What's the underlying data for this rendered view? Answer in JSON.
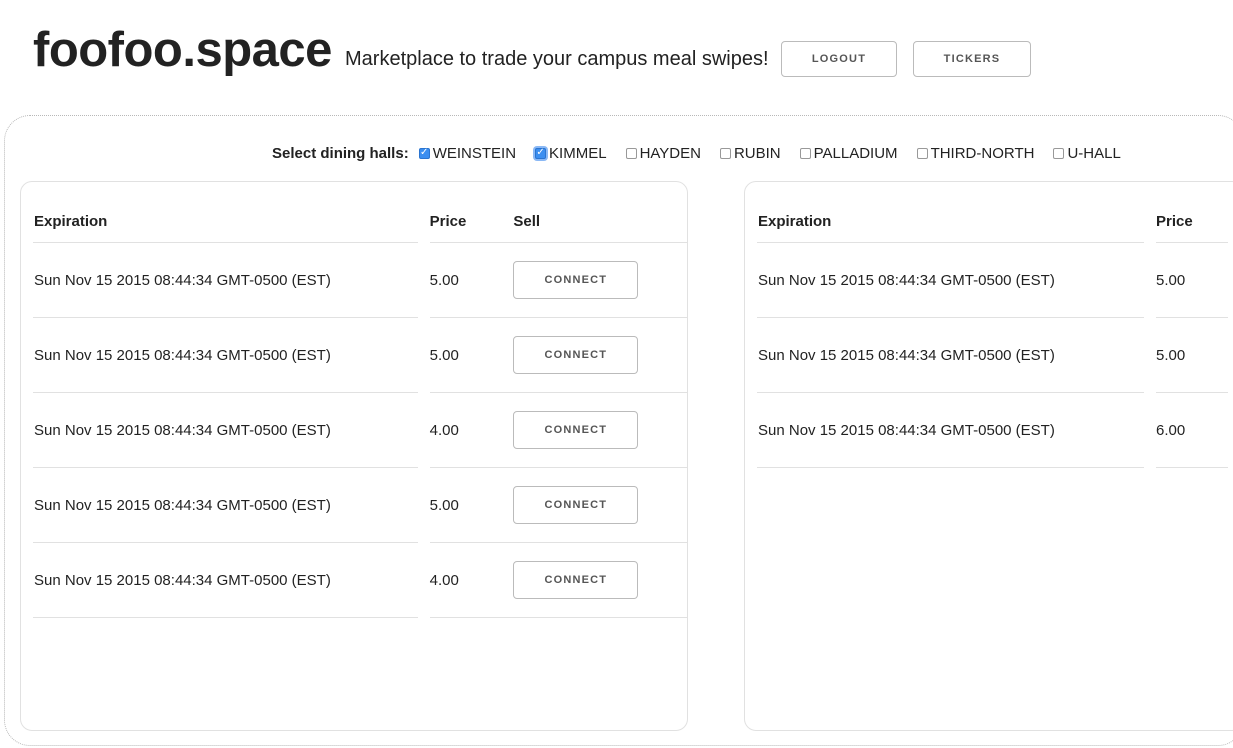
{
  "header": {
    "brand": "foofoo.space",
    "tagline": "Marketplace to trade your campus meal swipes!",
    "logout_label": "LOGOUT",
    "tickers_label": "TICKERS"
  },
  "filters": {
    "label": "Select dining halls:",
    "halls": [
      {
        "label": "WEINSTEIN",
        "checked": true
      },
      {
        "label": "KIMMEL",
        "checked": true
      },
      {
        "label": "HAYDEN",
        "checked": false
      },
      {
        "label": "RUBIN",
        "checked": false
      },
      {
        "label": "PALLADIUM",
        "checked": false
      },
      {
        "label": "THIRD-NORTH",
        "checked": false
      },
      {
        "label": "U-HALL",
        "checked": false
      }
    ]
  },
  "sell_table": {
    "columns": {
      "expiration": "Expiration",
      "price": "Price",
      "action": "Sell"
    },
    "connect_label": "CONNECT",
    "rows": [
      {
        "expiration": "Sun Nov 15 2015 08:44:34 GMT-0500 (EST)",
        "price": "5.00"
      },
      {
        "expiration": "Sun Nov 15 2015 08:44:34 GMT-0500 (EST)",
        "price": "5.00"
      },
      {
        "expiration": "Sun Nov 15 2015 08:44:34 GMT-0500 (EST)",
        "price": "4.00"
      },
      {
        "expiration": "Sun Nov 15 2015 08:44:34 GMT-0500 (EST)",
        "price": "5.00"
      },
      {
        "expiration": "Sun Nov 15 2015 08:44:34 GMT-0500 (EST)",
        "price": "4.00"
      }
    ]
  },
  "buy_table": {
    "columns": {
      "expiration": "Expiration",
      "price": "Price"
    },
    "rows": [
      {
        "expiration": "Sun Nov 15 2015 08:44:34 GMT-0500 (EST)",
        "price": "5.00"
      },
      {
        "expiration": "Sun Nov 15 2015 08:44:34 GMT-0500 (EST)",
        "price": "5.00"
      },
      {
        "expiration": "Sun Nov 15 2015 08:44:34 GMT-0500 (EST)",
        "price": "6.00"
      }
    ]
  },
  "colors": {
    "checkbox_checked": "#3b8ef0",
    "border": "#e1e1e1"
  }
}
